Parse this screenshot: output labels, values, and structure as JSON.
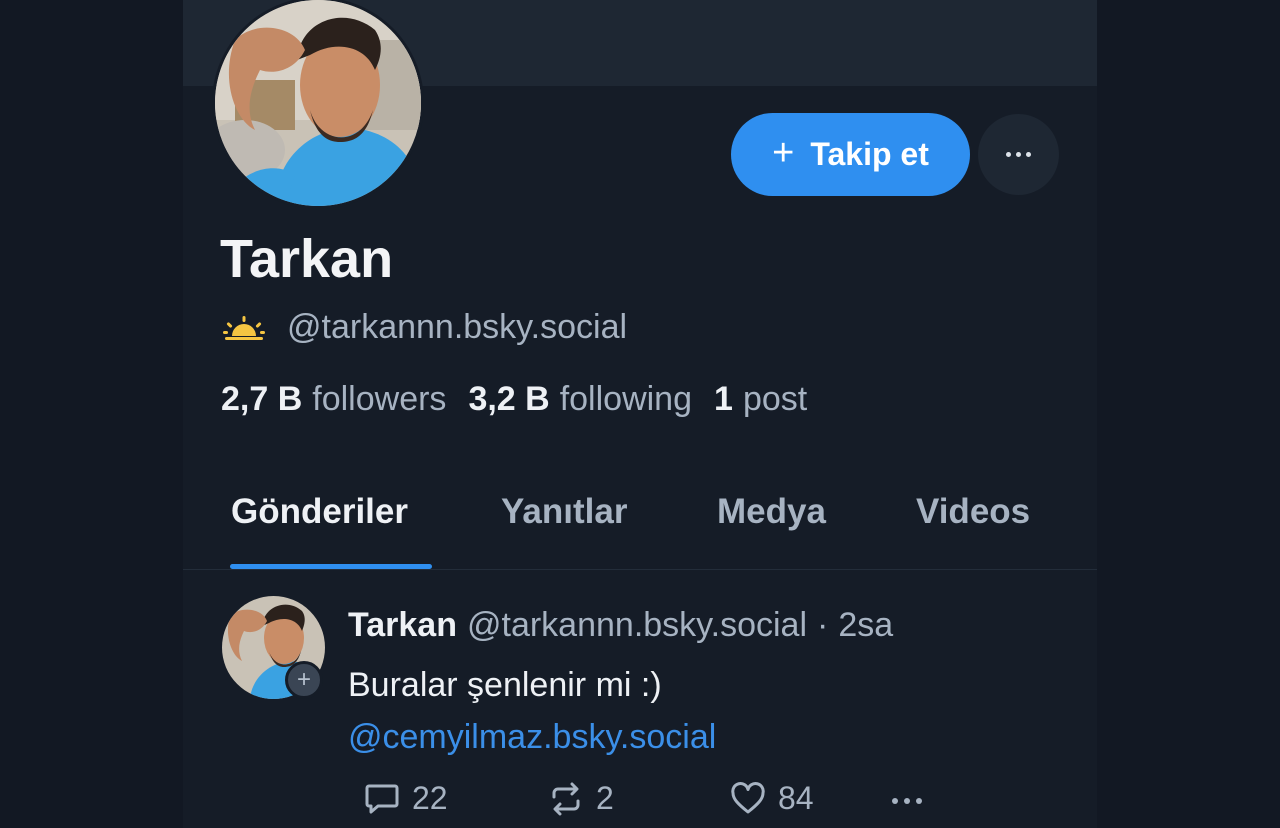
{
  "profile": {
    "name": "Tarkan",
    "handle": "@tarkannn.bsky.social",
    "follow_label": "Takip et",
    "stats": {
      "followers_count": "2,7 B",
      "followers_label": "followers",
      "following_count": "3,2 B",
      "following_label": "following",
      "posts_count": "1",
      "posts_label": "post"
    }
  },
  "tabs": [
    {
      "label": "Gönderiler",
      "active": true
    },
    {
      "label": "Yanıtlar",
      "active": false
    },
    {
      "label": "Medya",
      "active": false
    },
    {
      "label": "Videos",
      "active": false
    }
  ],
  "post": {
    "author": "Tarkan",
    "handle": "@tarkannn.bsky.social",
    "separator": "·",
    "time": "2sa",
    "text": "Buralar şenlenir mi :)",
    "mention": "@cemyilmaz.bsky.social",
    "replies": "22",
    "reposts": "2",
    "likes": "84"
  },
  "colors": {
    "accent": "#2f8ff0",
    "background": "#151c27",
    "muted_text": "#a7b3c2",
    "link": "#3b8fe8",
    "sun_icon": "#f5c542"
  },
  "icons": [
    "plus-icon",
    "more-icon",
    "sun-icon",
    "reply-icon",
    "repost-icon",
    "like-icon"
  ]
}
